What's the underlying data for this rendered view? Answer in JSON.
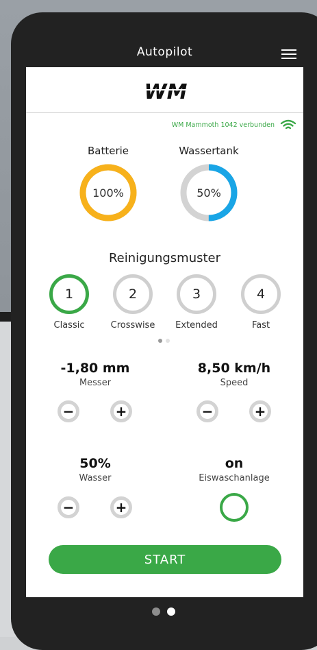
{
  "header": {
    "title": "Autopilot",
    "menu_icon": "hamburger-menu-icon"
  },
  "logo": {
    "text": "WM"
  },
  "connection": {
    "text": "WM Mammoth 1042 verbunden",
    "icon": "wifi-icon",
    "color": "#3aa847"
  },
  "gauges": [
    {
      "label": "Batterie",
      "value_text": "100%",
      "percent": 100,
      "color": "#f7b11b"
    },
    {
      "label": "Wassertank",
      "value_text": "50%",
      "percent": 50,
      "color": "#19a5e6"
    }
  ],
  "patterns": {
    "title": "Reinigungsmuster",
    "items": [
      {
        "number": "1",
        "label": "Classic",
        "active": true
      },
      {
        "number": "2",
        "label": "Crosswise",
        "active": false
      },
      {
        "number": "3",
        "label": "Extended",
        "active": false
      },
      {
        "number": "4",
        "label": "Fast",
        "active": false
      }
    ],
    "page_indicator": {
      "count": 2,
      "current": 1
    }
  },
  "controls": {
    "messer": {
      "value": "-1,80 mm",
      "label": "Messer",
      "minus": "−",
      "plus": "+"
    },
    "speed": {
      "value": "8,50 km/h",
      "label": "Speed",
      "minus": "−",
      "plus": "+"
    },
    "wasser": {
      "value": "50%",
      "label": "Wasser",
      "minus": "−",
      "plus": "+"
    },
    "eiswasch": {
      "value": "on",
      "label": "Eiswaschanlage"
    }
  },
  "start_label": "START",
  "pager": {
    "count": 2,
    "current": 2
  },
  "colors": {
    "accent": "#3aa847",
    "battery": "#f7b11b",
    "water": "#19a5e6",
    "inactive": "#d3d3d3"
  }
}
